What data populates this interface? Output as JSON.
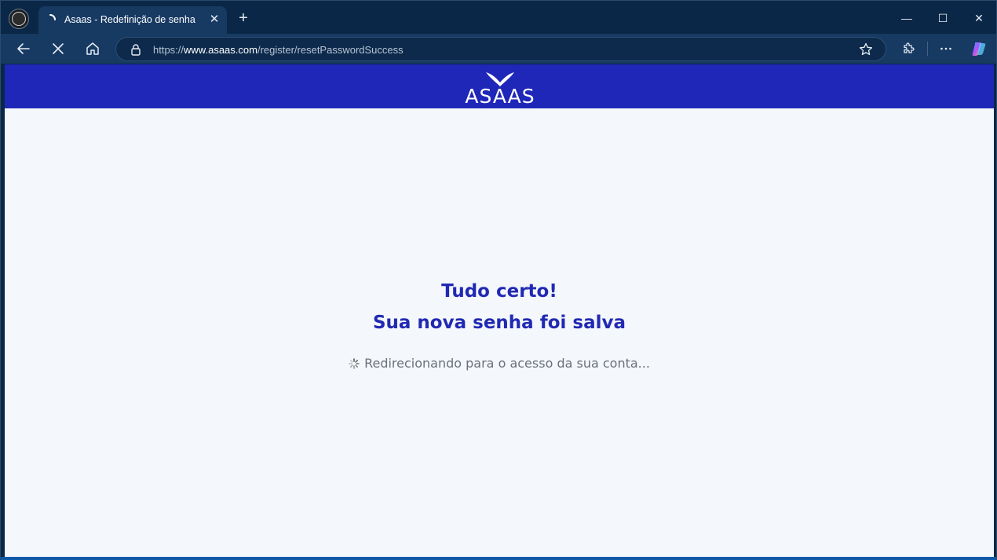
{
  "browser": {
    "tab_title": "Asaas - Redefinição de senha",
    "tab_close": "✕",
    "new_tab": "+",
    "url_scheme": "https://",
    "url_host": "www.asaas.com",
    "url_path": "/register/resetPasswordSuccess",
    "controls": {
      "minimize": "—",
      "maximize": "☐",
      "close": "✕"
    }
  },
  "page": {
    "brand": "ASAAS",
    "brand_color": "#1f27b8",
    "headline_line1": "Tudo certo!",
    "headline_line2": "Sua nova senha foi salva",
    "redirect_text": "Redirecionando para o acesso da sua conta...",
    "accent_color": "#2129b3"
  },
  "icons": {
    "back": "back-arrow-icon",
    "stop": "stop-loading-icon",
    "home": "home-icon",
    "lock": "lock-icon",
    "favorite": "star-icon",
    "extensions": "puzzle-icon",
    "menu": "more-icon",
    "copilot": "copilot-icon"
  }
}
